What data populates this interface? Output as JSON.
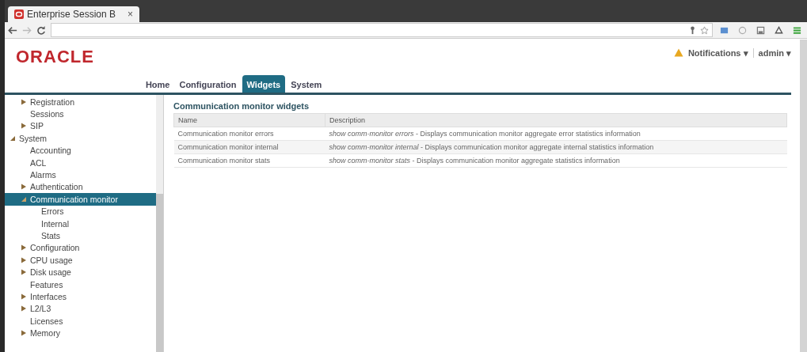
{
  "browser": {
    "tab_title": "Enterprise Session B",
    "close": "×"
  },
  "header": {
    "logo": "ORACLE",
    "nav": [
      {
        "label": "Home",
        "selected": false
      },
      {
        "label": "Configuration",
        "selected": false
      },
      {
        "label": "Widgets",
        "selected": true
      },
      {
        "label": "System",
        "selected": false
      }
    ],
    "notifications": "Notifications",
    "notifications_caret": "▾",
    "user": "admin",
    "user_caret": "▾"
  },
  "sidebar": {
    "partial_items": [
      {
        "label": "Registration",
        "expanded": false,
        "selected": false
      },
      {
        "label": "Sessions",
        "selected": false
      },
      {
        "label": "SIP",
        "expanded": false,
        "selected": false
      }
    ],
    "items": [
      {
        "label": "System",
        "expanded": true,
        "selected": false,
        "children": [
          {
            "label": "Accounting",
            "selected": false
          },
          {
            "label": "ACL",
            "selected": false
          },
          {
            "label": "Alarms",
            "selected": false
          },
          {
            "label": "Authentication",
            "expanded": false,
            "selected": false
          },
          {
            "label": "Communication monitor",
            "expanded": true,
            "selected": true,
            "children": [
              {
                "label": "Errors",
                "selected": false
              },
              {
                "label": "Internal",
                "selected": false
              },
              {
                "label": "Stats",
                "selected": false
              }
            ]
          },
          {
            "label": "Configuration",
            "expanded": false,
            "selected": false
          },
          {
            "label": "CPU usage",
            "expanded": false,
            "selected": false
          },
          {
            "label": "Disk usage",
            "expanded": false,
            "selected": false
          },
          {
            "label": "Features",
            "selected": false
          },
          {
            "label": "Interfaces",
            "expanded": false,
            "selected": false
          },
          {
            "label": "L2/L3",
            "expanded": false,
            "selected": false
          },
          {
            "label": "Licenses",
            "selected": false
          },
          {
            "label": "Memory",
            "expanded": false,
            "selected": false
          }
        ]
      }
    ]
  },
  "panel": {
    "title": "Communication monitor widgets",
    "table": {
      "columns": [
        "Name",
        "Description"
      ],
      "rows": [
        [
          "Communication monitor errors",
          "*show comm-monitor errors* - Displays communication monitor aggregate error statistics information"
        ],
        [
          "Communication monitor internal",
          "*show comm-monitor internal* - Displays communication monitor aggregate internal statistics information"
        ],
        [
          "Communication monitor stats",
          "*show comm-monitor stats* - Displays communication monitor aggregate statistics information"
        ]
      ]
    }
  }
}
